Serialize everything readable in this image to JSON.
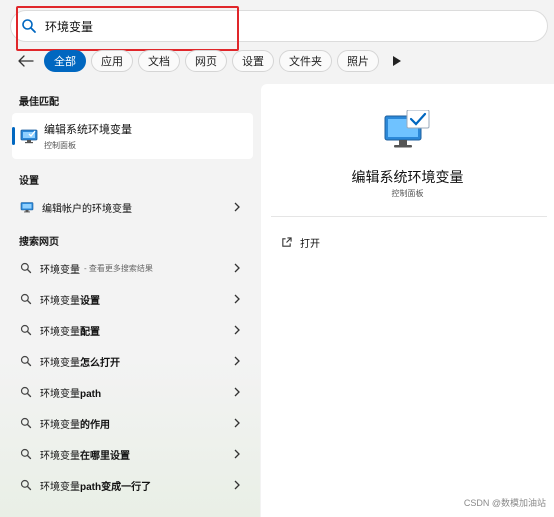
{
  "search": {
    "value": "环境变量"
  },
  "filters": {
    "back_label": "",
    "chips": [
      "全部",
      "应用",
      "文档",
      "网页",
      "设置",
      "文件夹",
      "照片"
    ]
  },
  "sections": {
    "best_match": "最佳匹配",
    "settings": "设置",
    "web": "搜索网页"
  },
  "best_match": {
    "title": "编辑系统环境变量",
    "subtitle": "控制面板"
  },
  "settings_items": [
    {
      "label": "编辑帐户的环境变量"
    }
  ],
  "web_items": [
    {
      "prefix": "环境变量",
      "suffix": "",
      "hint": "- 查看更多搜索结果"
    },
    {
      "prefix": "环境变量",
      "suffix": "设置",
      "hint": ""
    },
    {
      "prefix": "环境变量",
      "suffix": "配置",
      "hint": ""
    },
    {
      "prefix": "环境变量",
      "suffix": "怎么打开",
      "hint": ""
    },
    {
      "prefix": "环境变量",
      "suffix": "path",
      "hint": ""
    },
    {
      "prefix": "环境变量",
      "suffix": "的作用",
      "hint": ""
    },
    {
      "prefix": "环境变量",
      "suffix": "在哪里设置",
      "hint": ""
    },
    {
      "prefix": "环境变量",
      "suffix": "path变成一行了",
      "hint": ""
    }
  ],
  "detail": {
    "title": "编辑系统环境变量",
    "subtitle": "控制面板",
    "open_label": "打开"
  },
  "watermark": "CSDN @数模加油站",
  "colors": {
    "accent": "#0067c0",
    "highlight": "#e0262a"
  }
}
